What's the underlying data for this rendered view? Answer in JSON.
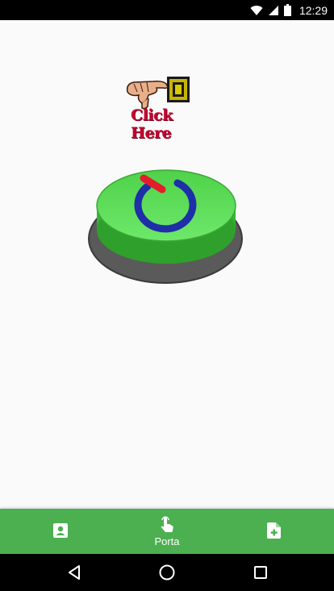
{
  "status_bar": {
    "time": "12:29",
    "icons": [
      "wifi-icon",
      "signal-icon",
      "battery-icon"
    ]
  },
  "main": {
    "click_here_text": "Click Here",
    "power_button_icon": "power-icon"
  },
  "bottom_nav": {
    "items": [
      {
        "icon": "contact-card-icon",
        "label": ""
      },
      {
        "icon": "touch-icon",
        "label": "Porta"
      },
      {
        "icon": "note-add-icon",
        "label": ""
      }
    ],
    "background": "#4caf50"
  },
  "system_nav": {
    "buttons": [
      "back-icon",
      "home-icon",
      "recents-icon"
    ]
  },
  "colors": {
    "button_green": "#5fd85a",
    "power_red": "#e51c2a",
    "power_blue": "#1e2fa8"
  }
}
